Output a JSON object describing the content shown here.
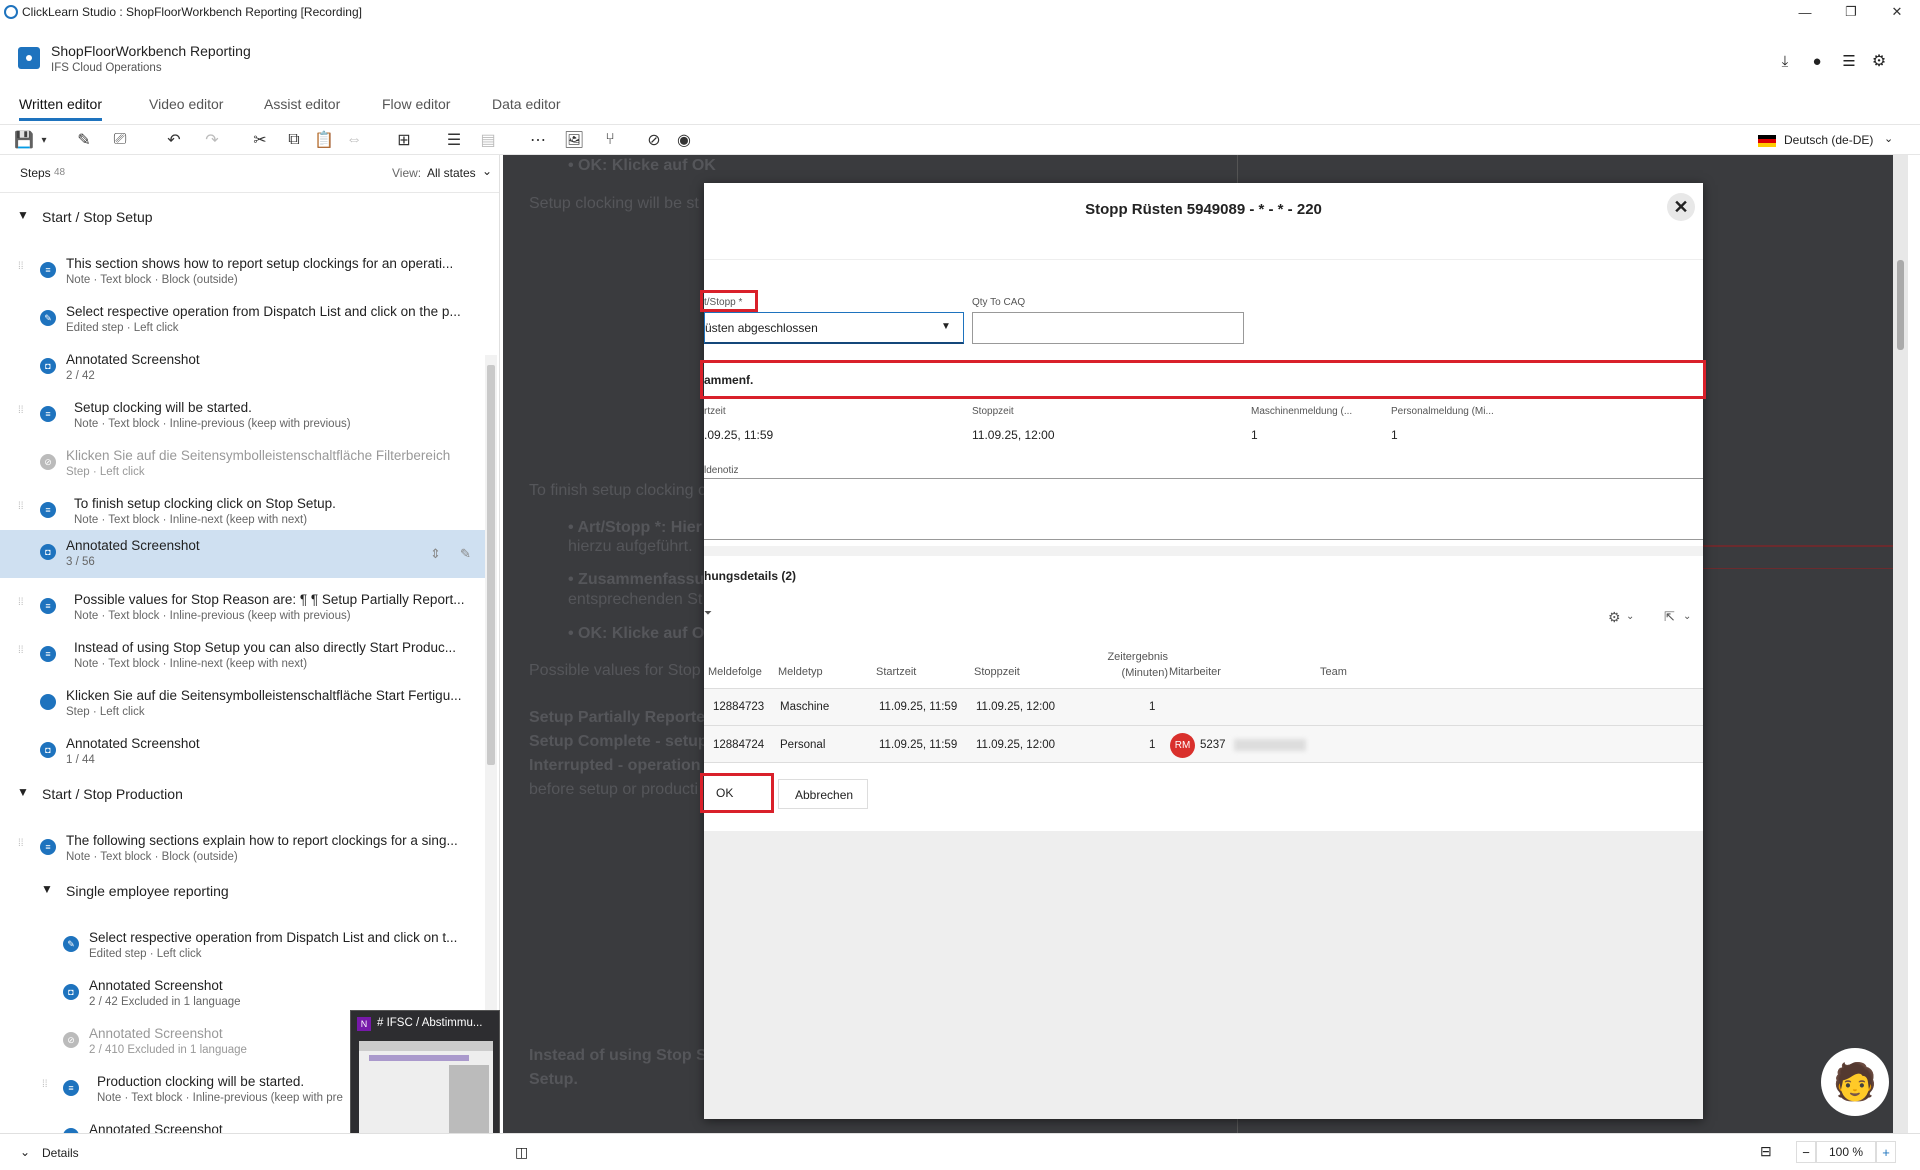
{
  "window": {
    "title": "ClickLearn Studio : ShopFloorWorkbench Reporting [Recording]",
    "minimize": "—",
    "restore": "❐",
    "close": "✕"
  },
  "header": {
    "doc_title": "ShopFloorWorkbench Reporting",
    "doc_subtitle": "IFS Cloud Operations",
    "tabs": [
      "Written editor",
      "Video editor",
      "Assist editor",
      "Flow editor",
      "Data editor"
    ],
    "language": "Deutsch (de-DE)"
  },
  "steps_panel": {
    "label": "Steps",
    "count": "48",
    "view_label": "View:",
    "view_value": "All states",
    "sections": [
      "Start / Stop Setup",
      "Start / Stop Production",
      "Single employee reporting"
    ],
    "steps": [
      {
        "title": "This section shows how to report setup clockings for an operati...",
        "sub": "Note · Text block · Block (outside)"
      },
      {
        "title": "Select respective operation from Dispatch List and click on the p...",
        "sub": "Edited step · Left click"
      },
      {
        "title": "Annotated Screenshot",
        "sub": "2 / 42"
      },
      {
        "title": "Setup clocking will be started.",
        "sub": "Note · Text block · Inline-previous (keep with previous)"
      },
      {
        "title": "Klicken Sie auf die Seitensymbolleistenschaltfläche Filterbereich",
        "sub": "Step · Left click"
      },
      {
        "title": "To finish setup clocking click on Stop Setup.",
        "sub": "Note · Text block · Inline-next (keep with next)"
      },
      {
        "title": "Annotated Screenshot",
        "sub": "3 / 56"
      },
      {
        "title": "Possible values for Stop Reason are: ¶ ¶ Setup Partially Report...",
        "sub": "Note · Text block · Inline-previous (keep with previous)"
      },
      {
        "title": "Instead of using Stop Setup you can also directly Start Produc...",
        "sub": "Note · Text block · Inline-next (keep with next)"
      },
      {
        "title": "Klicken Sie auf die Seitensymbolleistenschaltfläche Start Fertigu...",
        "sub": "Step · Left click"
      },
      {
        "title": "Annotated Screenshot",
        "sub": "1 / 44"
      },
      {
        "title": "The following sections explain how to report clockings for a sing...",
        "sub": "Note · Text block · Block (outside)"
      },
      {
        "title": "Select respective operation from Dispatch List and click on t...",
        "sub": "Edited step · Left click"
      },
      {
        "title": "Annotated Screenshot",
        "sub": "2 / 42    Excluded in 1 language"
      },
      {
        "title": "Annotated Screenshot",
        "sub": "2 / 410    Excluded in 1 language"
      },
      {
        "title": "Production clocking will be started.",
        "sub": "Note · Text block · Inline-previous (keep with pre"
      },
      {
        "title": "Annotated Screenshot",
        "sub": ""
      }
    ]
  },
  "background_doc": {
    "lines": [
      "• OK: Klicke auf OK",
      "Setup clocking will be st",
      "To finish setup clocking c",
      "• Art/Stopp *: Hier w",
      "hierzu aufgeführt.",
      "• Zusammenfassur",
      "entsprechenden St",
      "• OK: Klicke auf OK",
      "Possible values for Stop",
      "Setup Partially Reporte",
      "Setup Complete - setup",
      "Interrupted - operation",
      "before setup or producti",
      "Instead of using Stop Se",
      "Setup."
    ]
  },
  "dialog": {
    "title": "Stopp Rüsten 5949089 - * - * - 220",
    "art_stopp_label": "t/Stopp *",
    "art_stopp_value": "üsten abgeschlossen",
    "qty_label": "Qty To CAQ",
    "summary_label": "ammenf.",
    "startzeit_label": "rtzeit",
    "startzeit_value": ".09.25, 11:59",
    "stoppzeit_label": "Stoppzeit",
    "stoppzeit_value": "11.09.25, 12:00",
    "maschinen_label": "Maschinenmeldung (...",
    "maschinen_value": "1",
    "personal_label": "Personalmeldung (Mi...",
    "personal_value": "1",
    "note_label": "ldenotiz",
    "details_label": "hungsdetails (2)",
    "table": {
      "headers": [
        "Meldefolge",
        "Meldetyp",
        "Startzeit",
        "Stoppzeit",
        "Zeitergebnis (Minuten)",
        "Mitarbeiter",
        "Team"
      ],
      "rows": [
        [
          "12884723",
          "Maschine",
          "11.09.25, 11:59",
          "11.09.25, 12:00",
          "1",
          "",
          ""
        ],
        [
          "12884724",
          "Personal",
          "11.09.25, 11:59",
          "11.09.25, 12:00",
          "1",
          "5237",
          ""
        ]
      ],
      "avatar_initials": "RM"
    },
    "ok_label": "OK",
    "cancel_label": "Abbrechen"
  },
  "footer": {
    "details_label": "Details",
    "zoom": "100 %",
    "zoom_minus": "−",
    "zoom_plus": "+",
    "taskbar_preview": "# IFSC / Abstimmu..."
  },
  "colors": {
    "accent": "#1e73be",
    "highlight_red": "#d9202a",
    "selected_row": "#cfe0f1"
  }
}
